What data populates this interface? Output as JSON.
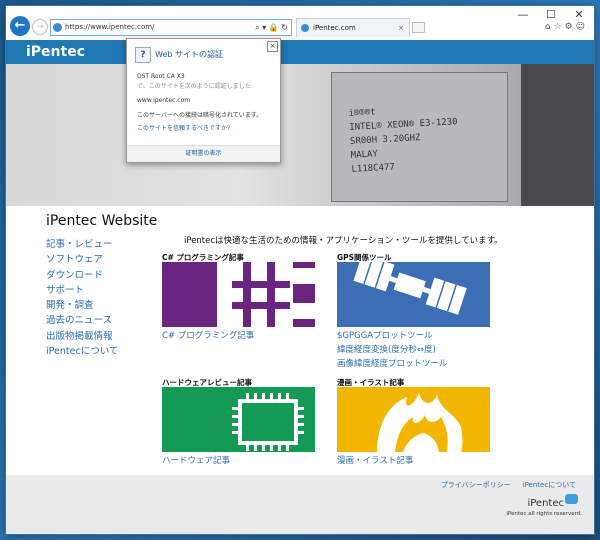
{
  "browser": {
    "url": "https://www.ipentec.com/",
    "tab_title": "iPentec.com",
    "window_controls": [
      "—",
      "☐",
      "✕"
    ],
    "toolbar_icons": [
      "⌂",
      "☆",
      "⚙",
      "☺"
    ],
    "addr_tools": "⌕ ▾ 🔒 ↻"
  },
  "site": {
    "logo": "iPentec",
    "title": "iPentec Website",
    "intro": "iPentecは快適な生活のための情報・アプリケーション・ツールを提供しています。"
  },
  "hero": {
    "cpu_text": "i®®®t\nINTEL® XEON® E3-1230\nSR00H 3.20GHZ\nMALAY\nL118C477"
  },
  "popup": {
    "title": "Web サイトの認証",
    "issuer": "DST Root CA X3",
    "issuer_note": "で、このサイトを次のように認証しました",
    "domain": "www.ipentec.com",
    "encryption": "このサーバーへの接続は暗号化されています。",
    "trust_link": "このサイトを信頼するべきですか?",
    "cert_button": "証明書の表示"
  },
  "nav": [
    "記事・レビュー",
    "ソフトウェア",
    "ダウンロード",
    "サポート",
    "開発・調査",
    "過去のニュース",
    "出版物掲載情報",
    "iPentecについて"
  ],
  "cards": [
    {
      "heading": "C# プログラミング記事",
      "color": "#6a2580",
      "links": [
        "C# プログラミング記事"
      ]
    },
    {
      "heading": "GPS関係ツール",
      "color": "#3b6eb5",
      "links": [
        "$GPGGAプロットツール",
        "緯度経度変換(度分秒⇔度)",
        "画像緯度経度プロットツール"
      ]
    },
    {
      "heading": "ハードウェアレビュー記事",
      "color": "#139a55",
      "links": [
        "ハードウェア記事"
      ]
    },
    {
      "heading": "漫画・イラスト記事",
      "color": "#f2b600",
      "links": [
        "漫画・イラスト記事"
      ]
    }
  ],
  "footer": {
    "links": [
      "プライバシーポリシー",
      "iPentecについて"
    ],
    "logo": "iPentec",
    "copyright": "iPentec all rights reserverd."
  }
}
